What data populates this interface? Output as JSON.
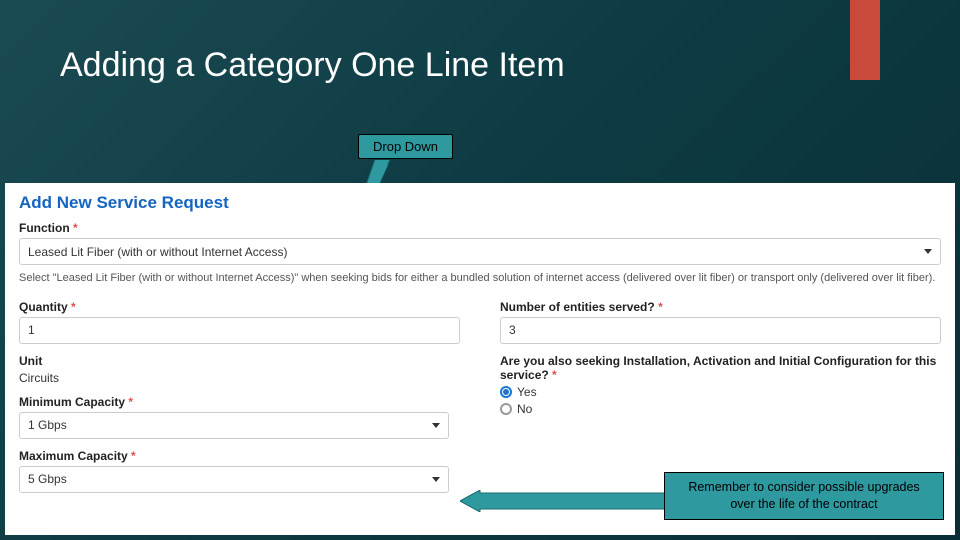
{
  "slide": {
    "title": "Adding a Category One Line Item",
    "callout_top": "Drop Down",
    "callout_bottom": "Remember to consider possible upgrades over the life of the contract"
  },
  "form": {
    "panel_title": "Add New Service Request",
    "function": {
      "label": "Function",
      "value": "Leased Lit Fiber (with or without Internet Access)",
      "hint": "Select \"Leased Lit Fiber (with or without Internet Access)\" when seeking bids for either a bundled solution of internet access (delivered over lit fiber) or transport only (delivered over lit fiber)."
    },
    "quantity": {
      "label": "Quantity",
      "value": "1"
    },
    "entities": {
      "label": "Number of entities served?",
      "value": "3"
    },
    "unit": {
      "label": "Unit",
      "value": "Circuits"
    },
    "installation": {
      "label": "Are you also seeking Installation, Activation and Initial Configuration for this service?",
      "yes": "Yes",
      "no": "No"
    },
    "min_capacity": {
      "label": "Minimum Capacity",
      "value": "1 Gbps"
    },
    "max_capacity": {
      "label": "Maximum Capacity",
      "value": "5 Gbps"
    }
  }
}
